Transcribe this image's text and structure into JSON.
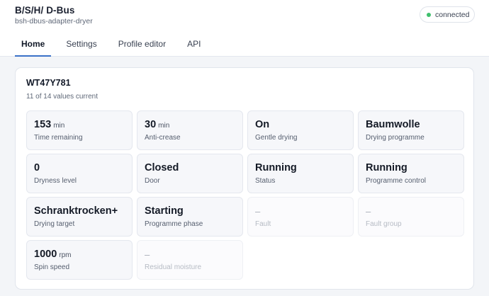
{
  "header": {
    "title": "B/S/H/ D-Bus",
    "subtitle": "bsh-dbus-adapter-dryer",
    "status": "connected",
    "status_color": "#3fbf6d"
  },
  "tabs": [
    {
      "label": "Home",
      "active": true
    },
    {
      "label": "Settings",
      "active": false
    },
    {
      "label": "Profile editor",
      "active": false
    },
    {
      "label": "API",
      "active": false
    }
  ],
  "device": {
    "model": "WT47Y781",
    "summary": "11 of 14 values current"
  },
  "tiles": [
    {
      "value": "153",
      "unit": "min",
      "label": "Time remaining",
      "current": true
    },
    {
      "value": "30",
      "unit": "min",
      "label": "Anti-crease",
      "current": true
    },
    {
      "value": "On",
      "unit": "",
      "label": "Gentle drying",
      "current": true
    },
    {
      "value": "Baumwolle",
      "unit": "",
      "label": "Drying programme",
      "current": true
    },
    {
      "value": "0",
      "unit": "",
      "label": "Dryness level",
      "current": true
    },
    {
      "value": "Closed",
      "unit": "",
      "label": "Door",
      "current": true
    },
    {
      "value": "Running",
      "unit": "",
      "label": "Status",
      "current": true
    },
    {
      "value": "Running",
      "unit": "",
      "label": "Programme control",
      "current": true
    },
    {
      "value": "Schranktrocken+",
      "unit": "",
      "label": "Drying target",
      "current": true
    },
    {
      "value": "Starting",
      "unit": "",
      "label": "Programme phase",
      "current": true
    },
    {
      "value": "–",
      "unit": "",
      "label": "Fault",
      "current": false
    },
    {
      "value": "–",
      "unit": "",
      "label": "Fault group",
      "current": false
    },
    {
      "value": "1000",
      "unit": "rpm",
      "label": "Spin speed",
      "current": true
    },
    {
      "value": "–",
      "unit": "",
      "label": "Residual moisture",
      "current": false
    }
  ]
}
